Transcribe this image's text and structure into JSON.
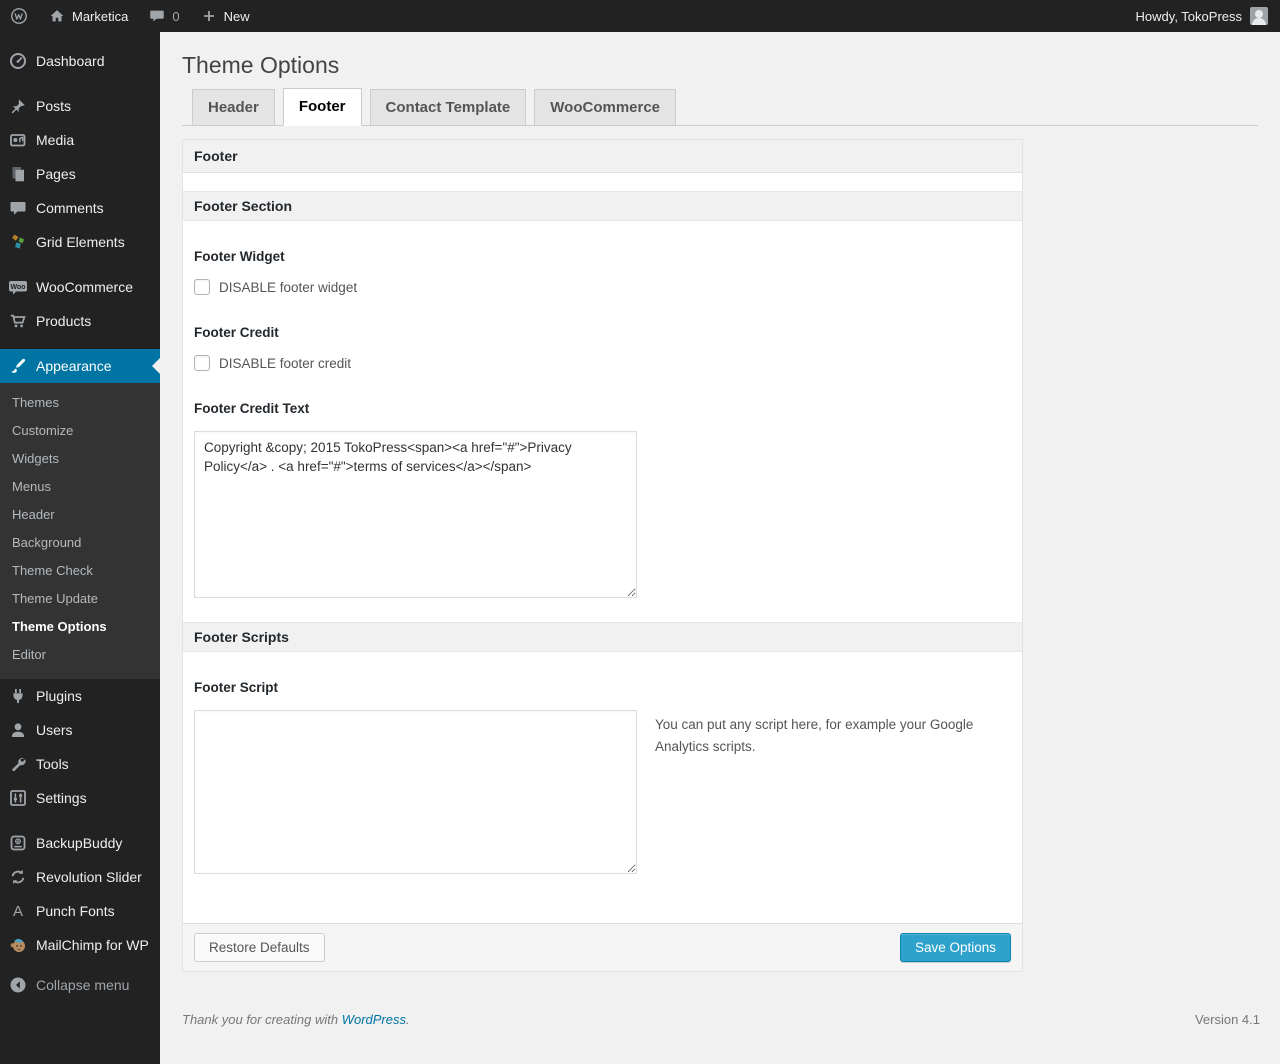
{
  "admin_bar": {
    "site_name": "Marketica",
    "comments_count": "0",
    "new_label": "New",
    "howdy": "Howdy, TokoPress"
  },
  "sidebar": {
    "items": [
      {
        "label": "Dashboard"
      },
      {
        "label": "Posts"
      },
      {
        "label": "Media"
      },
      {
        "label": "Pages"
      },
      {
        "label": "Comments"
      },
      {
        "label": "Grid Elements"
      },
      {
        "label": "WooCommerce"
      },
      {
        "label": "Products"
      },
      {
        "label": "Appearance"
      },
      {
        "label": "Plugins"
      },
      {
        "label": "Users"
      },
      {
        "label": "Tools"
      },
      {
        "label": "Settings"
      },
      {
        "label": "BackupBuddy"
      },
      {
        "label": "Revolution Slider"
      },
      {
        "label": "Punch Fonts"
      },
      {
        "label": "MailChimp for WP"
      },
      {
        "label": "Collapse menu"
      }
    ],
    "appearance_submenu": [
      "Themes",
      "Customize",
      "Widgets",
      "Menus",
      "Header",
      "Background",
      "Theme Check",
      "Theme Update",
      "Theme Options",
      "Editor"
    ],
    "icons": {
      "woo_badge_text": "Woo",
      "punch_fonts_letter": "A"
    }
  },
  "main": {
    "page_title": "Theme Options",
    "tabs": [
      {
        "label": "Header",
        "active": false
      },
      {
        "label": "Footer",
        "active": true
      },
      {
        "label": "Contact Template",
        "active": false
      },
      {
        "label": "WooCommerce",
        "active": false
      }
    ],
    "panel": {
      "header": "Footer",
      "footer_section_title": "Footer Section",
      "footer_widget_label": "Footer Widget",
      "footer_widget_checkbox": "DISABLE footer widget",
      "footer_credit_label": "Footer Credit",
      "footer_credit_checkbox": "DISABLE footer credit",
      "footer_credit_text_label": "Footer Credit Text",
      "footer_credit_text_value": "Copyright &copy; 2015 TokoPress<span><a href=\"#\">Privacy Policy</a> . <a href=\"#\">terms of services</a></span>",
      "footer_scripts_title": "Footer Scripts",
      "footer_script_label": "Footer Script",
      "footer_script_value": "",
      "footer_script_help": "You can put any script here, for example your Google Analytics scripts.",
      "restore_button": "Restore Defaults",
      "save_button": "Save Options"
    }
  },
  "page_footer": {
    "thanks_prefix": "Thank you for creating with ",
    "wordpress_link": "WordPress",
    "thanks_suffix": ".",
    "version": "Version 4.1"
  },
  "colors": {
    "admin_bar_bg": "#222222",
    "sidebar_bg": "#222222",
    "submenu_bg": "#333333",
    "active_menu_blue": "#0074a2",
    "primary_button_blue": "#2ea2cc",
    "page_bg": "#f1f1f1",
    "link_blue": "#0074a2"
  }
}
